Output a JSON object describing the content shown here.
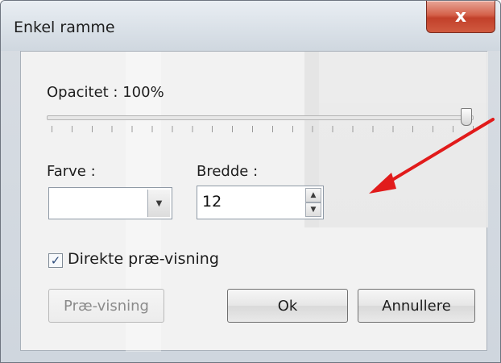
{
  "window": {
    "title": "Enkel ramme",
    "close_glyph": "x"
  },
  "opacity": {
    "label": "Opacitet : 100%",
    "value_fraction": 1.0
  },
  "color": {
    "label": "Farve :",
    "current_color": "#ffffff"
  },
  "width": {
    "label": "Bredde :",
    "value": "12"
  },
  "live_preview": {
    "label": "Direkte præ-visning",
    "checked": true
  },
  "buttons": {
    "preview": "Præ-visning",
    "ok": "Ok",
    "cancel": "Annullere"
  },
  "icons": {
    "close": "close-icon",
    "combo": "chevron-down-icon",
    "spin_up": "spin-up-icon",
    "spin_down": "spin-down-icon",
    "check": "checkmark-icon",
    "annotation": "red-arrow-annotation"
  },
  "colors": {
    "annotation_arrow": "#e11b1b",
    "close_button": "#c2402a"
  }
}
